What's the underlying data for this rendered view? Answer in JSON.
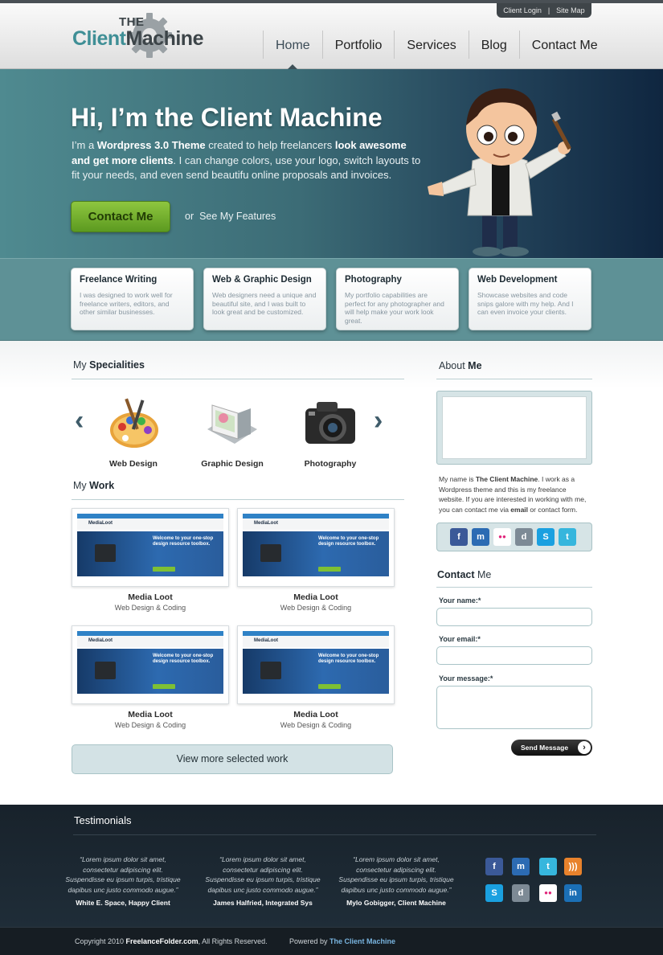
{
  "header": {
    "top_links": [
      "Client Login",
      "|",
      "Site Map"
    ],
    "logo_the": "THE",
    "logo_part1": "Client",
    "logo_part2": "Machine",
    "nav": [
      "Home",
      "Portfolio",
      "Services",
      "Blog",
      "Contact Me"
    ],
    "active_nav": "Home"
  },
  "hero": {
    "title": "Hi, I’m the Client Machine",
    "text_1": "I’m a ",
    "text_bold_1": "Wordpress 3.0 Theme",
    "text_2": " created to help freelancers ",
    "text_bold_2": "look awesome and get more clients",
    "text_3": ". I can change colors, use your logo, switch layouts to fit your needs, and even send beautifu online proposals and invoices.",
    "cta_label": "Contact Me",
    "or_label": "or",
    "features_link": "See My Features"
  },
  "features": [
    {
      "title": "Freelance Writing",
      "text": "I was designed to work well for freelance writers, editors, and other similar businesses."
    },
    {
      "title": "Web & Graphic Design",
      "text": "Web designers need a unique and beautiful site, and I was built to look great and be customized."
    },
    {
      "title": "Photography",
      "text": "My portfolio capabilities are perfect for any photographer and will help make your work look great."
    },
    {
      "title": "Web Development",
      "text": "Showcase websites and code snips galore with my help. And I can even invoice your clients."
    }
  ],
  "specialities": {
    "title_prefix": "My",
    "title_bold": "Specialities",
    "items": [
      "Web Design",
      "Graphic Design",
      "Photography"
    ]
  },
  "work": {
    "title_prefix": "My",
    "title_bold": "Work",
    "items": [
      {
        "title": "Media Loot",
        "subtitle": "Web Design & Coding"
      },
      {
        "title": "Media Loot",
        "subtitle": "Web Design & Coding"
      },
      {
        "title": "Media Loot",
        "subtitle": "Web Design & Coding"
      },
      {
        "title": "Media Loot",
        "subtitle": "Web Design & Coding"
      }
    ],
    "thumb_logo": "MediaLoot",
    "thumb_heading": "Welcome to your one-stop design resource toolbox.",
    "more_button": "View more selected work"
  },
  "about": {
    "title_prefix": "About",
    "title_bold": "Me",
    "text_1": "My name is ",
    "text_bold_1": "The Client Machine",
    "text_2": ". I work as a Wordpress theme and this is my freelance website. If you are interested in working with me, you can contact me via ",
    "text_bold_2": "email",
    "text_3": " or contact form."
  },
  "social": [
    {
      "name": "facebook-icon",
      "glyph": "f",
      "color": "#3b5998"
    },
    {
      "name": "myspace-icon",
      "glyph": "m",
      "color": "#2c6bb3"
    },
    {
      "name": "flickr-icon",
      "glyph": "●●",
      "color": "#ffffff"
    },
    {
      "name": "digg-icon",
      "glyph": "d",
      "color": "#7d8a95"
    },
    {
      "name": "skype-icon",
      "glyph": "S",
      "color": "#1aa0e0"
    },
    {
      "name": "twitter-icon",
      "glyph": "t",
      "color": "#36b6dd"
    }
  ],
  "contact": {
    "title_bold": "Contact",
    "title_suffix": "Me",
    "name_label": "Your name:*",
    "email_label": "Your email:*",
    "message_label": "Your message:*",
    "send_label": "Send Message",
    "send_chevron": "›"
  },
  "testimonials": {
    "title": "Testimonials",
    "items": [
      {
        "quote": "“Lorem ipsum dolor sit amet, consectetur adipiscing elit. Suspendisse eu ipsum turpis, tristique dapibus unc justo commodo augue.”",
        "author": "White E. Space, Happy Client"
      },
      {
        "quote": "“Lorem ipsum dolor sit amet, consectetur adipiscing elit. Suspendisse eu ipsum turpis, tristique dapibus unc justo commodo augue.”",
        "author": "James Halfried, Integrated Sys"
      },
      {
        "quote": "“Lorem ipsum dolor sit amet, consectetur adipiscing elit. Suspendisse eu ipsum turpis, tristique dapibus unc justo commodo augue.”",
        "author": "Mylo Gobigger, Client Machine"
      }
    ]
  },
  "footer_social": [
    {
      "name": "facebook-icon",
      "glyph": "f",
      "color": "#3b5998"
    },
    {
      "name": "myspace-icon",
      "glyph": "m",
      "color": "#2c6bb3"
    },
    {
      "name": "twitter-icon",
      "glyph": "t",
      "color": "#36b6dd"
    },
    {
      "name": "rss-icon",
      "glyph": ")))",
      "color": "#e8822c"
    },
    {
      "name": "skype-icon",
      "glyph": "S",
      "color": "#1aa0e0"
    },
    {
      "name": "digg-icon",
      "glyph": "d",
      "color": "#7d8a95"
    },
    {
      "name": "flickr-icon",
      "glyph": "●●",
      "color": "#ffffff"
    },
    {
      "name": "linkedin-icon",
      "glyph": "in",
      "color": "#1b6fb5"
    }
  ],
  "bottom": {
    "copyright_1": "Copyright 2010 ",
    "copyright_site": "FreelanceFolder.com",
    "copyright_2": ", All Rights Reserved.",
    "powered_by": "Powered by ",
    "powered_name": "The Client Machine"
  }
}
